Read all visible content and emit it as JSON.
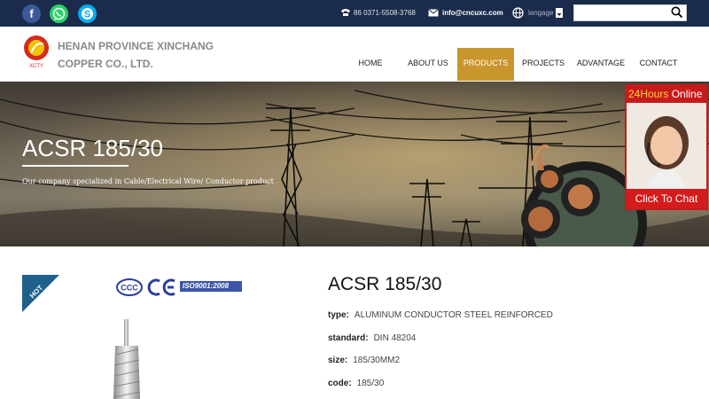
{
  "topbar": {
    "phone": "86 0371-5508-3768",
    "email": "info@cncuxc.com",
    "language": "langage",
    "search_placeholder": ""
  },
  "header": {
    "logo_text": "XCTY",
    "company_line1": "HENAN PROVINCE XINCHANG",
    "company_line2": "COPPER CO., LTD."
  },
  "nav": {
    "items": [
      {
        "label": "HOME"
      },
      {
        "label": "ABOUT US"
      },
      {
        "label": "PRODUCTS"
      },
      {
        "label": "PROJECTS"
      },
      {
        "label": "ADVANTAGE"
      },
      {
        "label": "CONTACT"
      }
    ],
    "active": "PRODUCTS"
  },
  "hero": {
    "title": "ACSR 185/30",
    "subtitle": "Our company specialized in Cable/Electrical Wire/ Conductor product"
  },
  "chat": {
    "hours": "24Hours",
    "online": "Online",
    "button": "Click To Chat"
  },
  "product": {
    "badge": "HOT",
    "cert_iso": "ISO9001:2008",
    "name": "ACSR 185/30",
    "specs": [
      {
        "label": "type:",
        "value": "ALUMINUM CONDUCTOR STEEL REINFORCED"
      },
      {
        "label": "standard:",
        "value": "DIN 48204"
      },
      {
        "label": "size:",
        "value": "185/30MM2"
      },
      {
        "label": "code:",
        "value": "185/30"
      }
    ]
  },
  "colors": {
    "topbar": "#1b2b4b",
    "accent": "#c9962d",
    "facebook": "#3b5998",
    "whatsapp": "#25d366",
    "skype": "#00aff0",
    "chat_red": "#c71a1a"
  }
}
